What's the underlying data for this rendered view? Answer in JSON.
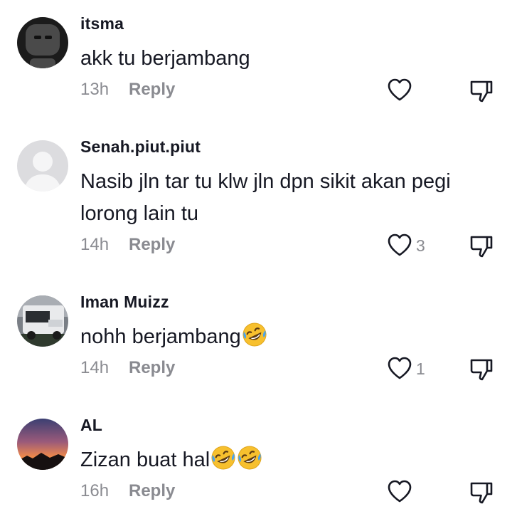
{
  "comments": [
    {
      "username": "itsma",
      "text": "akk tu berjambang",
      "emojis": 0,
      "time": "13h",
      "reply_label": "Reply",
      "likes": ""
    },
    {
      "username": "Senah.piut.piut",
      "text": "Nasib jln tar tu klw jln dpn sikit akan pegi lorong lain tu",
      "emojis": 0,
      "time": "14h",
      "reply_label": "Reply",
      "likes": "3"
    },
    {
      "username": "Iman Muizz",
      "text": "nohh berjambang",
      "emojis": 1,
      "time": "14h",
      "reply_label": "Reply",
      "likes": "1"
    },
    {
      "username": "AL",
      "text": "Zizan buat hal",
      "emojis": 2,
      "time": "16h",
      "reply_label": "Reply",
      "likes": ""
    }
  ],
  "icons": {
    "like": "heart-outline-icon",
    "dislike": "thumbs-down-icon",
    "emoji": "rolling-on-the-floor-laughing-emoji"
  },
  "colors": {
    "text": "#161823",
    "secondary": "#8a8b91",
    "emoji": "#f7c02e"
  }
}
